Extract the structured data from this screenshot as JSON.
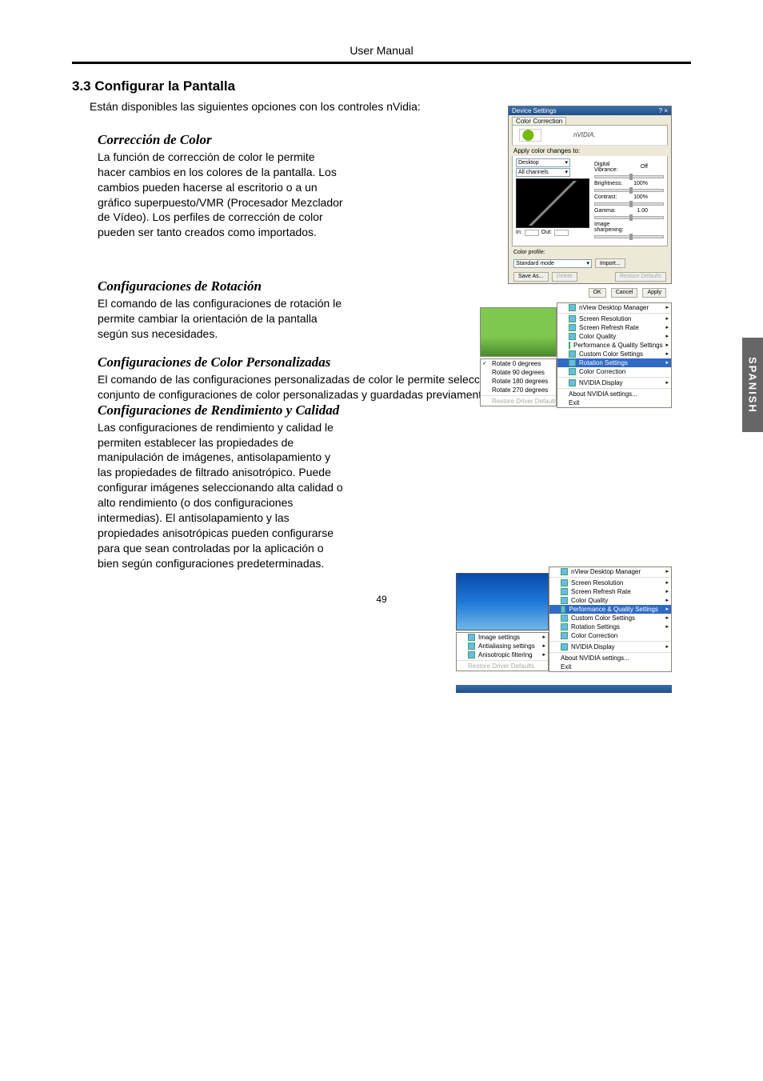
{
  "header": {
    "title": "User Manual"
  },
  "section": {
    "number_title": "3.3 Configurar la Pantalla"
  },
  "intro": "Están disponibles las siguientes opciones con los controles nVidia:",
  "side_tab": "SPANISH",
  "page_number": "49",
  "s1": {
    "heading": "Corrección de Color",
    "body": "La función de corrección de color le permite hacer cambios en los colores de la pantalla. Los cambios pueden hacerse al escritorio o a un gráfico superpuesto/VMR (Procesador Mezclador de Vídeo). Los perfiles de corrección de color pueden ser tanto creados como importados."
  },
  "s2": {
    "heading": "Configuraciones de Rotación",
    "body": "El comando de las configuraciones de rotación le permite cambiar la orientación de la pantalla según sus necesidades."
  },
  "s3": {
    "heading": "Configuraciones de Color Personalizadas",
    "body": "El comando de las configuraciones personalizadas de color le permite seleccionar un conjunto de configuraciones de color personalizadas y guardadas previamente."
  },
  "s4": {
    "heading": "Configuraciones de Rendimiento y Calidad",
    "body": "Las configuraciones de rendimiento y calidad le permiten establecer las propiedades de manipulación de imágenes, antisolapamiento y las propiedades de filtrado anisotrópico. Puede configurar imágenes seleccionando alta calidad o alto rendimiento (o dos configuraciones intermedias). El antisolapamiento y las propiedades anisotrópicas pueden configurarse para que sean controladas por la aplicación o bien según configuraciones predeterminadas."
  },
  "fig1": {
    "title": "Device Settings",
    "close": "? ×",
    "tab": "Color Correction",
    "brand": "nVIDIA.",
    "apply": "Apply color changes to:",
    "dd_desktop": "Desktop",
    "dd_channels": "All channels",
    "dv_label": "Digital Vibrance:",
    "dv_val": "Off",
    "brightness": "Brightness:",
    "brightness_v": "100%",
    "contrast": "Contrast:",
    "contrast_v": "100%",
    "gamma": "Gamma:",
    "gamma_v": "1.00",
    "in_label": "In:",
    "out_label": "Out:",
    "sharpen": "Image sharpening:",
    "profile_label": "Color profile:",
    "profile_val": "Standard mode",
    "import": "Import...",
    "saveas": "Save As...",
    "delete": "Delete",
    "restore": "Restore Defaults",
    "ok": "OK",
    "cancel": "Cancel",
    "apply_btn": "Apply"
  },
  "fig2": {
    "m1_0": "Rotate 0 degrees",
    "m1_1": "Rotate 90 degrees",
    "m1_2": "Rotate 180 degrees",
    "m1_3": "Rotate 270 degrees",
    "m1_4": "Restore Driver Defaults",
    "m2_0": "nView Desktop Manager",
    "m2_1": "Screen Resolution",
    "m2_2": "Screen Refresh Rate",
    "m2_3": "Color Quality",
    "m2_4": "Performance & Quality Settings",
    "m2_5": "Custom Color Settings",
    "m2_6": "Rotation Settings",
    "m2_7": "Color Correction",
    "m2_8": "NVIDIA Display",
    "m2_9": "About NVIDIA settings...",
    "m2_10": "Exit"
  },
  "fig3": {
    "m1_0": "Image settings",
    "m1_1": "Antialiasing settings",
    "m1_2": "Anisotropic filtering",
    "m1_3": "Restore Driver Defaults",
    "m2_0": "nView Desktop Manager",
    "m2_1": "Screen Resolution",
    "m2_2": "Screen Refresh Rate",
    "m2_3": "Color Quality",
    "m2_4": "Performance & Quality Settings",
    "m2_5": "Custom Color Settings",
    "m2_6": "Rotation Settings",
    "m2_7": "Color Correction",
    "m2_8": "NVIDIA Display",
    "m2_9": "About NVIDIA settings...",
    "m2_10": "Exit"
  }
}
